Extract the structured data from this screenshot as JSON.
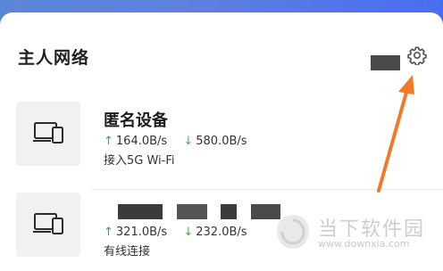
{
  "section": {
    "title": "主人网络"
  },
  "icons": {
    "settings": "gear-icon",
    "device": "devices-icon"
  },
  "devices": [
    {
      "name": "匿名设备",
      "upload": "164.0B/s",
      "download": "580.0B/s",
      "connection": "接入5G Wi-Fi"
    },
    {
      "name": "",
      "upload": "321.0B/s",
      "download": "232.0B/s",
      "connection": "有线连接"
    }
  ],
  "symbols": {
    "up": "↑",
    "down": "↓"
  },
  "watermark": {
    "brand": "当下软件园",
    "url": "www.downxia.com"
  },
  "colors": {
    "header_gradient": "#5b86d8",
    "annotation_arrow": "#f07a2a",
    "up_arrow": "#1ea7a0",
    "down_arrow": "#4caf50"
  }
}
